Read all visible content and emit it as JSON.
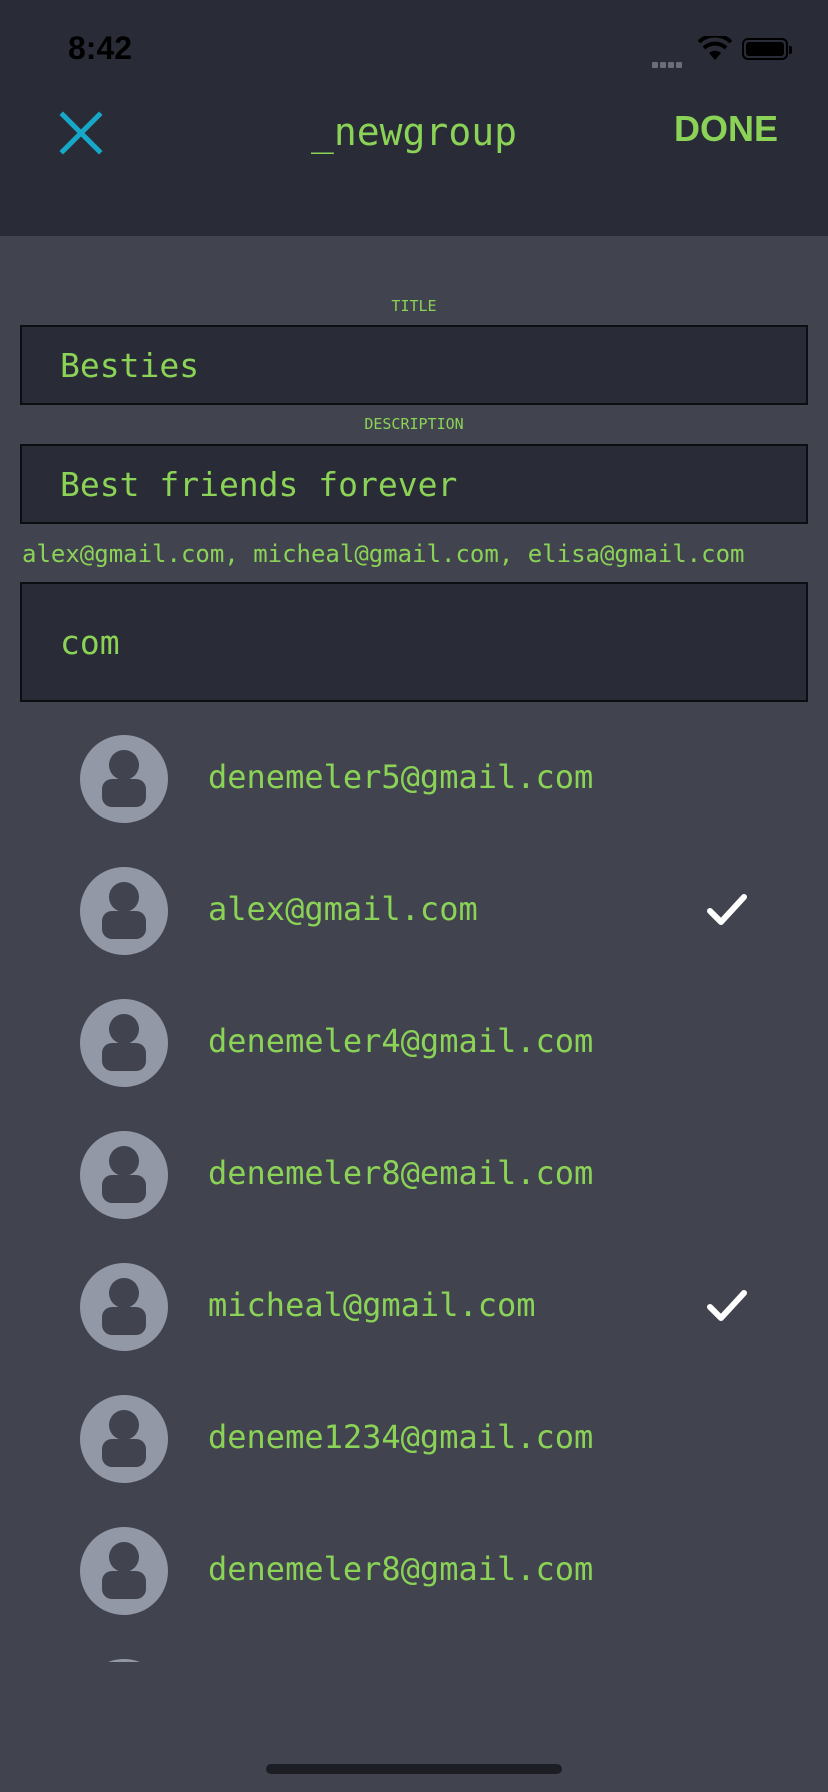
{
  "status_bar": {
    "time": "8:42"
  },
  "nav": {
    "title": "_newgroup",
    "done_label": "DONE"
  },
  "form": {
    "title_label": "TITLE",
    "title_value": "Besties",
    "description_label": "DESCRIPTION",
    "description_value": "Best friends forever",
    "selected_members": "alex@gmail.com, micheal@gmail.com, elisa@gmail.com",
    "search_value": "com"
  },
  "contacts": [
    {
      "email": "denemeler5@gmail.com",
      "selected": false
    },
    {
      "email": "alex@gmail.com",
      "selected": true
    },
    {
      "email": "denemeler4@gmail.com",
      "selected": false
    },
    {
      "email": "denemeler8@email.com",
      "selected": false
    },
    {
      "email": "micheal@gmail.com",
      "selected": true
    },
    {
      "email": "deneme1234@gmail.com",
      "selected": false
    },
    {
      "email": "denemeler8@gmail.com",
      "selected": false
    },
    {
      "email": "",
      "selected": false
    }
  ],
  "colors": {
    "accent_green": "#8bd356",
    "close_blue": "#17a8c9",
    "header_bg": "#292c36",
    "body_bg": "#41444f"
  }
}
